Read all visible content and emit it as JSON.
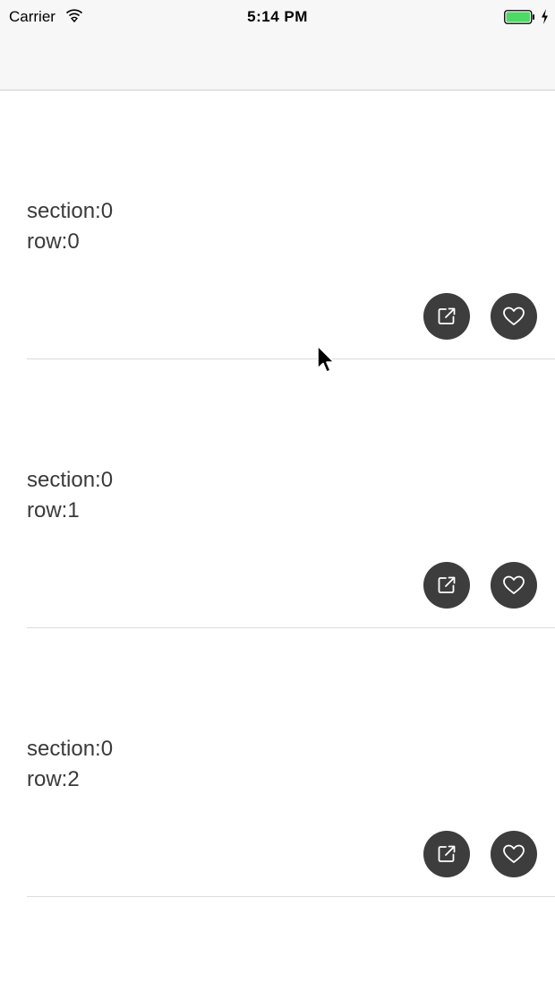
{
  "status_bar": {
    "carrier": "Carrier",
    "time": "5:14 PM",
    "battery_color": "#4cd964"
  },
  "icons": {
    "wifi": "wifi-icon",
    "battery": "battery-icon",
    "share": "share-external-icon",
    "like": "heart-icon",
    "cursor": "mouse-pointer-icon"
  },
  "table": {
    "cells": [
      {
        "section_text": "section:0",
        "row_text": "row:0"
      },
      {
        "section_text": "section:0",
        "row_text": "row:1"
      },
      {
        "section_text": "section:0",
        "row_text": "row:2"
      }
    ]
  },
  "colors": {
    "button_bg": "#3d3d3d",
    "text": "#3a3a3a",
    "separator": "#dcdcdc"
  }
}
